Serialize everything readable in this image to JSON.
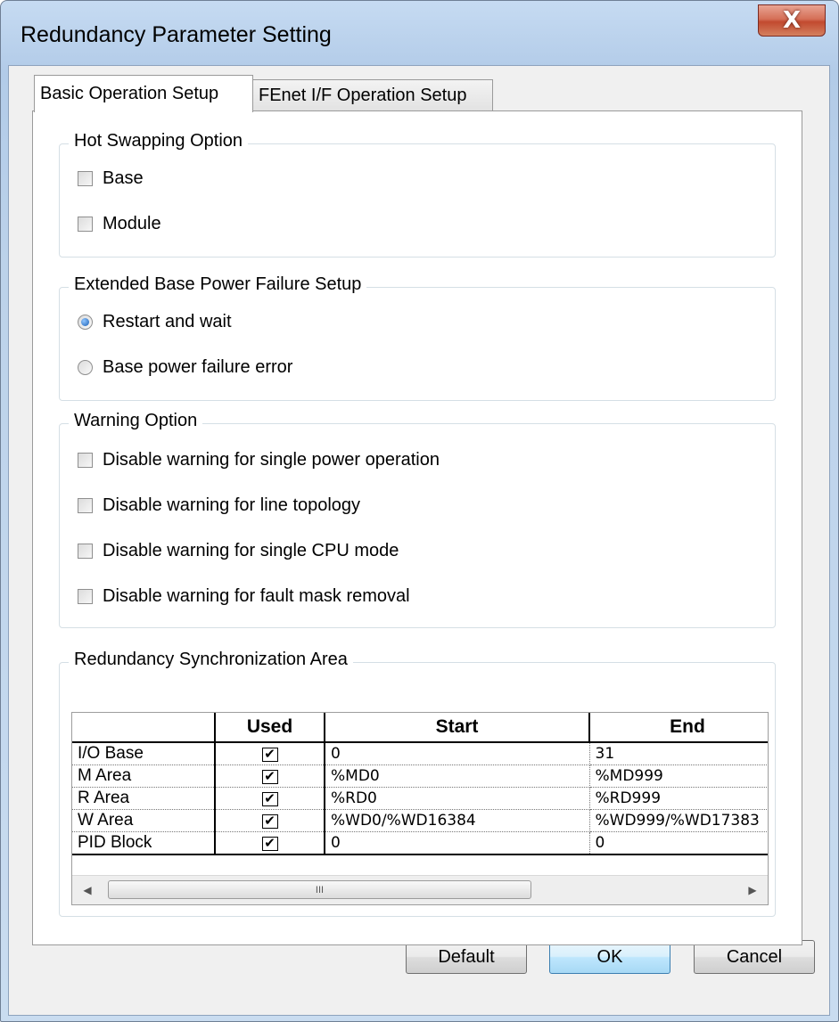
{
  "window": {
    "title": "Redundancy Parameter Setting",
    "close_glyph": "X"
  },
  "tabs": [
    {
      "label": "Basic Operation Setup",
      "active": true
    },
    {
      "label": "FEnet I/F Operation Setup",
      "active": false
    }
  ],
  "hot_swapping": {
    "legend": "Hot Swapping Option",
    "options": [
      {
        "label": "Base",
        "checked": false
      },
      {
        "label": "Module",
        "checked": false
      }
    ]
  },
  "power_failure": {
    "legend": "Extended Base Power Failure Setup",
    "options": [
      {
        "label": "Restart and wait",
        "selected": true
      },
      {
        "label": "Base power failure error",
        "selected": false
      }
    ]
  },
  "warning": {
    "legend": "Warning Option",
    "options": [
      {
        "label": "Disable warning for single power operation",
        "checked": false
      },
      {
        "label": "Disable warning for line topology",
        "checked": false
      },
      {
        "label": "Disable warning for single CPU mode",
        "checked": false
      },
      {
        "label": "Disable warning for fault mask removal",
        "checked": false
      }
    ]
  },
  "sync_area": {
    "legend": "Redundancy Synchronization Area",
    "columns": [
      "",
      "Used",
      "Start",
      "End"
    ],
    "rows": [
      {
        "name": "I/O Base",
        "used": "✔",
        "start": "0",
        "end": "31"
      },
      {
        "name": "M Area",
        "used": "✔",
        "start": "%MD0",
        "end": "%MD999"
      },
      {
        "name": "R Area",
        "used": "✔",
        "start": "%RD0",
        "end": "%RD999"
      },
      {
        "name": "W Area",
        "used": "✔",
        "start": "%WD0/%WD16384",
        "end": "%WD999/%WD17383"
      },
      {
        "name": "PID Block",
        "used": "✔",
        "start": "0",
        "end": "0"
      }
    ],
    "scroll": {
      "left_arrow": "◀",
      "right_arrow": "▶",
      "thumb_grip": "III"
    }
  },
  "buttons": {
    "default": "Default",
    "ok": "OK",
    "cancel": "Cancel"
  }
}
